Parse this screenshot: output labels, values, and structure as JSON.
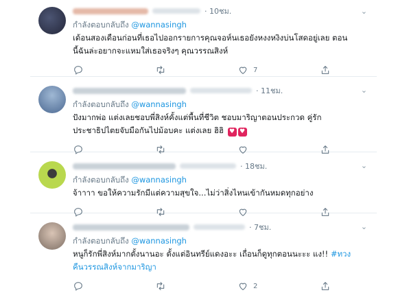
{
  "tweets": [
    {
      "time": "· 10ชม.",
      "reply_prefix": "กำลังตอบกลับถึง",
      "reply_to": "@wannasingh",
      "text_lines": [
        "เด้อนสองเดือนก่อนที่เธอไปออกรายการคุณจอห์นเธอยังหงงหงิงบ่นโสดอยู่เลย ตอน",
        "นี้ฉันล่ะอยากจะแหมใส่เธอจริงๆ คุณวรรณสิงห์"
      ],
      "reply_count": "",
      "retweet_count": "",
      "like_count": "7",
      "avatar_color": "#3a3f5c"
    },
    {
      "time": "· 11ชม.",
      "reply_prefix": "กำลังตอบกลับถึง",
      "reply_to": "@wannasingh",
      "text_lines": [
        "ปังมากพ่อ แต่งเลยชอบพี่สิงห์คั้งแต่พื้นที่ชีวิต ชอบมาริญาตอนประกวด คู่รัก",
        "ประชาธิปไตยจับมือกันไปม้อบคะ แต่งเลย ฮิฮิ"
      ],
      "reply_count": "",
      "retweet_count": "",
      "like_count": "",
      "avatar_color": "#6d8fb4"
    },
    {
      "time": "· 18ชม.",
      "reply_prefix": "กำลังตอบกลับถึง",
      "reply_to": "@wannasingh",
      "text_lines": [
        "จ้าาาา ขอให้ความรักมีแต่ความสุขใจ...ไม่ว่าสิ่งไหนเข้ากันหมดทุกอย่าง"
      ],
      "reply_count": "",
      "retweet_count": "",
      "like_count": "",
      "avatar_color": "#9bc23a"
    },
    {
      "time": "· 7ชม.",
      "reply_prefix": "กำลังตอบกลับถึง",
      "reply_to": "@wannasingh",
      "text_lines": [
        "หนูก็รักพี่สิงห์มากตั้งนานอะ ตั้งแต่อินทรีย์แดงอะะ เถื่อนก็ดูทุกตอนนะะะ แง!!",
        "คืนวรรณสิงห์จากมาริญา"
      ],
      "hashtag": "#ทวง",
      "reply_count": "",
      "retweet_count": "",
      "like_count": "2",
      "avatar_color": "#b9a89a"
    }
  ],
  "icons": {
    "reply": "reply-icon",
    "retweet": "retweet-icon",
    "like": "like-icon",
    "share": "share-icon",
    "more": "chevron-down-icon"
  }
}
